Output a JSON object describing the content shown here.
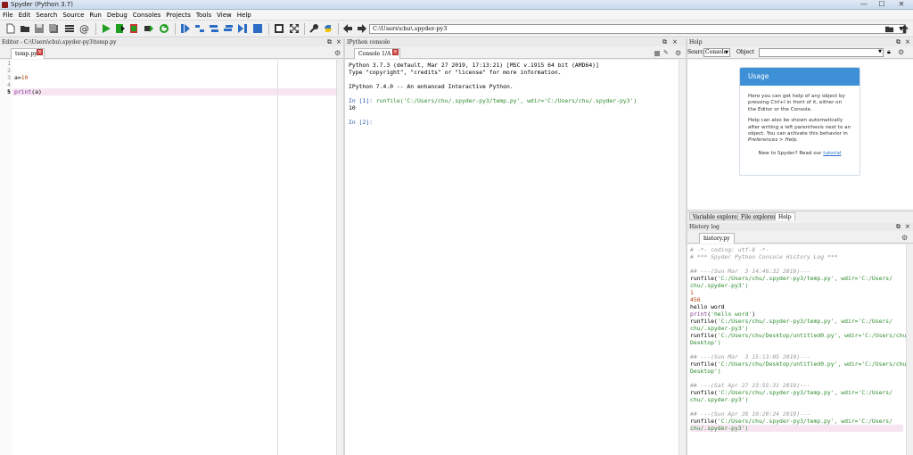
{
  "window": {
    "title": "Spyder (Python 3.7)",
    "min": "—",
    "max": "☐",
    "close": "✕"
  },
  "menu": [
    "File",
    "Edit",
    "Search",
    "Source",
    "Run",
    "Debug",
    "Consoles",
    "Projects",
    "Tools",
    "View",
    "Help"
  ],
  "toolbar": {
    "path": "C:\\Users\\chu\\.spyder-py3"
  },
  "editor": {
    "header": "Editor - C:\\Users\\chu\\.spyder-py3\\temp.py",
    "tab": "temp.py",
    "line_numbers": [
      "1",
      "2",
      "3",
      "4",
      "5"
    ],
    "lines": [
      "",
      "",
      "a=10",
      "",
      "print(a)"
    ],
    "current_line": "5"
  },
  "console": {
    "header": "IPython console",
    "tab": "Console 1/A",
    "lines": [
      "Python 3.7.3 (default, Mar 27 2019, 17:13:21) [MSC v.1915 64 bit (AMD64)]",
      "Type \"copyright\", \"credits\" or \"license\" for more information.",
      "",
      "IPython 7.4.0 -- An enhanced Interactive Python.",
      ""
    ],
    "in1_prompt": "In [1]: ",
    "in1_code": "runfile('C:/Users/chu/.spyder-py3/temp.py', wdir='C:/Users/chu/.spyder-py3')",
    "out1": "10",
    "in2_prompt": "In [2]: "
  },
  "help": {
    "header": "Help",
    "source_label": "Source",
    "source_value": "Console",
    "object_label": "Object",
    "usage_title": "Usage",
    "usage_p1": "Here you can get help of any object by pressing Ctrl+I in front of it, either on the Editor or the Console.",
    "usage_p2a": "Help can also be shown automatically after writing a left parenthesis next to an object. You can activate this behavior in ",
    "usage_p2b": "Preferences > Help.",
    "usage_p3a": "New to Spyder? Read our ",
    "usage_p3b": "tutorial",
    "tabs": [
      "Variable explorer",
      "File explorer",
      "Help"
    ]
  },
  "history": {
    "header": "History log",
    "tab": "history.py",
    "lines": [
      {
        "t": "# -*- coding: utf-8 -*-",
        "c": "com"
      },
      {
        "t": "# *** Spyder Python Console History Log ***",
        "c": "com"
      },
      {
        "t": "",
        "c": ""
      },
      {
        "t": "## ---(Sun Mar  3 14:46:32 2019)---",
        "c": "com"
      },
      {
        "t": "runfile('C:/Users/chu/.spyder-py3/temp.py', wdir='C:/Users/",
        "c": "run"
      },
      {
        "t": "chu/.spyder-py3')",
        "c": "str"
      },
      {
        "t": "1",
        "c": "num"
      },
      {
        "t": "456",
        "c": "num"
      },
      {
        "t": "hello word",
        "c": ""
      },
      {
        "t": "print('hello word')",
        "c": "print"
      },
      {
        "t": "runfile('C:/Users/chu/.spyder-py3/temp.py', wdir='C:/Users/",
        "c": "run"
      },
      {
        "t": "chu/.spyder-py3')",
        "c": "str"
      },
      {
        "t": "runfile('C:/Users/chu/Desktop/untitled0.py', wdir='C:/Users/chu/",
        "c": "run"
      },
      {
        "t": "Desktop')",
        "c": "str"
      },
      {
        "t": "",
        "c": ""
      },
      {
        "t": "## ---(Sun Mar  3 15:13:05 2019)---",
        "c": "com"
      },
      {
        "t": "runfile('C:/Users/chu/Desktop/untitled0.py', wdir='C:/Users/chu/",
        "c": "run"
      },
      {
        "t": "Desktop')",
        "c": "str"
      },
      {
        "t": "",
        "c": ""
      },
      {
        "t": "## ---(Sat Apr 27 23:55:31 2019)---",
        "c": "com"
      },
      {
        "t": "runfile('C:/Users/chu/.spyder-py3/temp.py', wdir='C:/Users/",
        "c": "run"
      },
      {
        "t": "chu/.spyder-py3')",
        "c": "str"
      },
      {
        "t": "",
        "c": ""
      },
      {
        "t": "## ---(Sun Apr 28 10:20:24 2019)---",
        "c": "com"
      },
      {
        "t": "runfile('C:/Users/chu/.spyder-py3/temp.py', wdir='C:/Users/",
        "c": "run"
      },
      {
        "t": "chu/.spyder-py3')",
        "c": "str"
      }
    ]
  },
  "colors": {
    "accent": "#3d8fd6",
    "run_green": "#1f9e1f",
    "stop_blue": "#2b6cc4"
  }
}
